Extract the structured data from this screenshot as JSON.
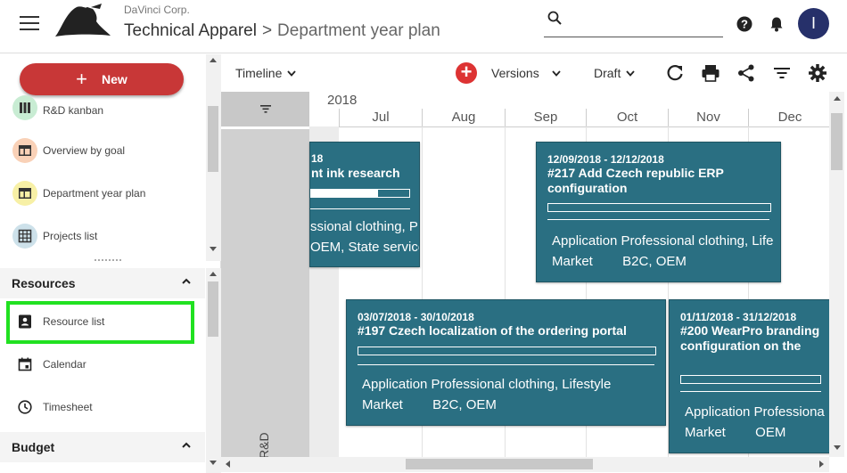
{
  "header": {
    "company": "DaVinci Corp.",
    "project": "Technical Apparel",
    "separator": ">",
    "page": "Department year plan",
    "search_placeholder": "",
    "avatar_initial": "I"
  },
  "sidebar": {
    "new_label": "New",
    "items": [
      {
        "label": "R&D kanban",
        "icon": "kanban-icon",
        "color": "#c8ecd3"
      },
      {
        "label": "Overview by goal",
        "icon": "layout-icon",
        "color": "#f9d1b7"
      },
      {
        "label": "Department year plan",
        "icon": "layout-icon",
        "color": "#f7f0a6"
      },
      {
        "label": "Projects list",
        "icon": "grid-icon",
        "color": "#cde1ea"
      }
    ],
    "resources_label": "Resources",
    "resources_items": [
      {
        "label": "Resource list",
        "icon": "contact-book-icon"
      },
      {
        "label": "Calendar",
        "icon": "calendar-icon"
      },
      {
        "label": "Timesheet",
        "icon": "clock-icon"
      }
    ],
    "budget_label": "Budget"
  },
  "toolbar": {
    "timeline_label": "Timeline",
    "versions_label": "Versions",
    "draft_label": "Draft"
  },
  "timeline": {
    "year": "2018",
    "months": [
      "Jul",
      "Aug",
      "Sep",
      "Oct",
      "Nov",
      "Dec"
    ],
    "lane": "R&D"
  },
  "cards": [
    {
      "date": "18",
      "title": "nt ink research",
      "progress": 0.68,
      "fields_line1": "ssional clothing, P",
      "fields_line2": "OEM, State service"
    },
    {
      "date": "12/09/2018 - 12/12/2018",
      "title": "#217 Add Czech republic ERP configuration",
      "progress": 0,
      "fields_line1": "Application Professional clothing, Life",
      "fields_line2": "Market        B2C, OEM"
    },
    {
      "date": "03/07/2018 - 30/10/2018",
      "title": "#197 Czech localization of the ordering portal",
      "progress": 0,
      "fields_line1": "Application Professional clothing, Lifestyle",
      "fields_line2": "Market        B2C, OEM"
    },
    {
      "date": "01/11/2018 - 31/12/2018",
      "title": "#200 WearPro branding configuration on the",
      "progress": 0,
      "fields_line1": "Application Professiona",
      "fields_line2": "Market        OEM"
    }
  ],
  "colors": {
    "card_bg": "#2a6f82",
    "new_button": "#c83737",
    "highlight": "#21e121",
    "avatar": "#26306a"
  }
}
